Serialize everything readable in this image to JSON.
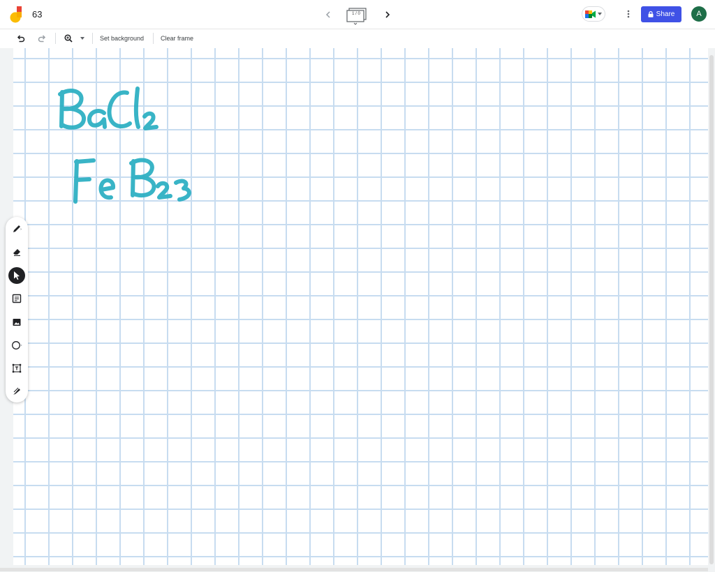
{
  "header": {
    "title": "63",
    "frame_counter": "1 / 0",
    "share_label": "Share",
    "avatar_initial": "A"
  },
  "toolbar": {
    "set_background_label": "Set background",
    "clear_frame_label": "Clear frame"
  },
  "canvas": {
    "handwriting": [
      "BaCl2",
      "FeBr3"
    ],
    "ink_color": "#29aec2",
    "grid_color": "#c7dcf0"
  },
  "tools": [
    {
      "name": "pen-tool",
      "icon": "pen-icon",
      "active": false
    },
    {
      "name": "eraser-tool",
      "icon": "eraser-icon",
      "active": false
    },
    {
      "name": "select-tool",
      "icon": "cursor-arrow-icon",
      "active": true
    },
    {
      "name": "sticky-note-tool",
      "icon": "sticky-note-icon",
      "active": false
    },
    {
      "name": "image-tool",
      "icon": "image-icon",
      "active": false
    },
    {
      "name": "shape-tool",
      "icon": "circle-icon",
      "active": false
    },
    {
      "name": "text-box-tool",
      "icon": "text-box-icon",
      "active": false
    },
    {
      "name": "laser-tool",
      "icon": "laser-pointer-icon",
      "active": false
    }
  ],
  "colors": {
    "brand": "#3f51e6",
    "avatar": "#1e6e48"
  }
}
